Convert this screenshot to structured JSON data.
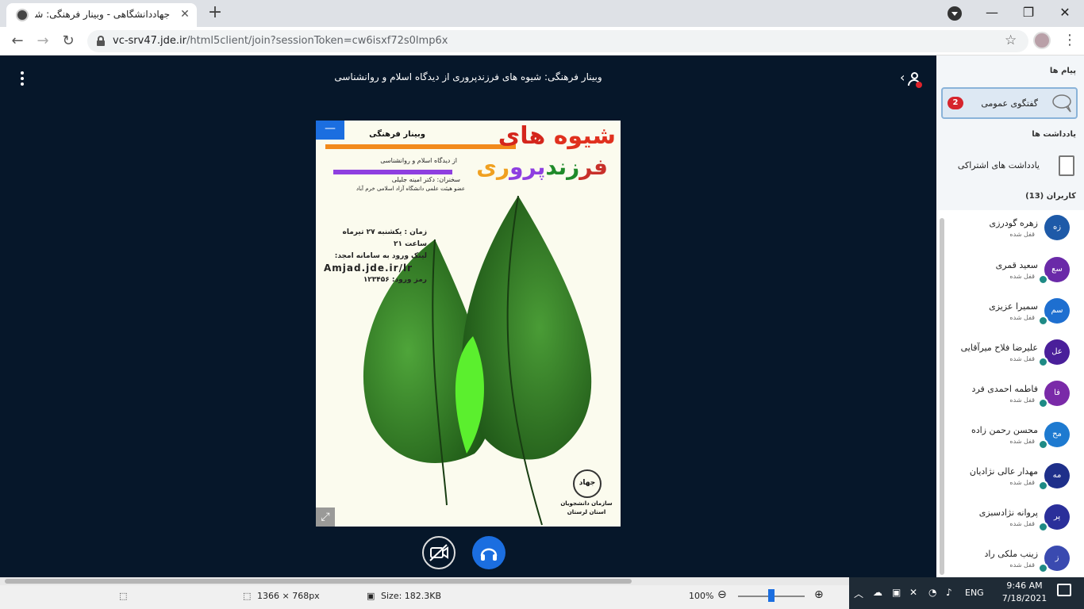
{
  "browser": {
    "tab_title": "جهاددانشگاهی - وبینار فرهنگی: شیوه",
    "tab_close": "✕",
    "new_tab": "+",
    "url_host": "vc-srv47.jde.ir",
    "url_path": "/html5client/join?sessionToken=cw6isxf72s0lmp6x",
    "star": "☆",
    "back": "←",
    "forward": "→",
    "reload": "↻",
    "min": "—",
    "max": "❐",
    "close": "✕",
    "menu": "⋮"
  },
  "meeting": {
    "title": "وبینار فرهنگی: شیوه های فرزندپروری از دیدگاه اسلام و روانشناسی"
  },
  "slide": {
    "minimize": "—",
    "fullscreen": "⤢",
    "webinar": "وبینار فرهنگی",
    "title_line1": "شیوه های",
    "title_line2": "فرزندپروری",
    "subtitle": "از دیدگاه اسلام و روانشناسی",
    "speaker": "سخنران: دکتر امینه جلیلی",
    "affiliation": "عضو هیئت علمی دانشگاه آزاد اسلامی خرم آباد",
    "time": "زمان : یکشنبه ۲۷ تیرماه",
    "hour": "ساعت ۲۱",
    "link_label": "لینک ورود به سامانه امجد:",
    "link": "Amjad.jde.ir/lr",
    "password": "رمز ورود: ۱۲۳۴۵۶",
    "seal": "جهاد",
    "org": "سازمان دانشجویان استان لرستان"
  },
  "panel": {
    "messages_title": "پیام ها",
    "public_chat": "گفتگوی عمومی",
    "chat_badge": "2",
    "notes_title": "یادداشت ها",
    "shared_notes": "یادداشت های اشتراکی",
    "users_title": "کاربران (13)",
    "users": [
      {
        "initials": "زه",
        "name": "زهره گودرزی",
        "status": "قفل شده",
        "color": "#1e5aa8",
        "mic": false
      },
      {
        "initials": "سع",
        "name": "سعید قمری",
        "status": "قفل شده",
        "color": "#6a2aa8",
        "mic": true
      },
      {
        "initials": "سم",
        "name": "سمیرا عزیزی",
        "status": "قفل شده",
        "color": "#1e6fd0",
        "mic": true
      },
      {
        "initials": "عل",
        "name": "علیرضا فلاح میرآقایی",
        "status": "قفل شده",
        "color": "#4a1f9a",
        "mic": true
      },
      {
        "initials": "فا",
        "name": "فاطمه احمدی فرد",
        "status": "قفل شده",
        "color": "#7a2aa8",
        "mic": true
      },
      {
        "initials": "مح",
        "name": "محسن رحمن زاده",
        "status": "قفل شده",
        "color": "#1e7ad0",
        "mic": true
      },
      {
        "initials": "مه",
        "name": "مهدار عالی نژادیان",
        "status": "قفل شده",
        "color": "#1e2f8a",
        "mic": true
      },
      {
        "initials": "پر",
        "name": "پروانه نژادسبزی",
        "status": "قفل شده",
        "color": "#2a2f9a",
        "mic": true
      },
      {
        "initials": "ز",
        "name": "زینب ملکی راد",
        "status": "قفل شده",
        "color": "#3a4ab0",
        "mic": true
      }
    ]
  },
  "statusbar": {
    "dimensions": "1366 × 768px",
    "size": "Size: 182.3KB",
    "zoom": "100%",
    "zoom_out": "⊖",
    "zoom_in": "⊕"
  },
  "taskbar": {
    "lang": "ENG",
    "time": "9:46 AM",
    "date": "7/18/2021"
  },
  "colors": {
    "accent": "#1b6ee0",
    "badge": "#d6242c",
    "main_bg": "#06172a"
  }
}
